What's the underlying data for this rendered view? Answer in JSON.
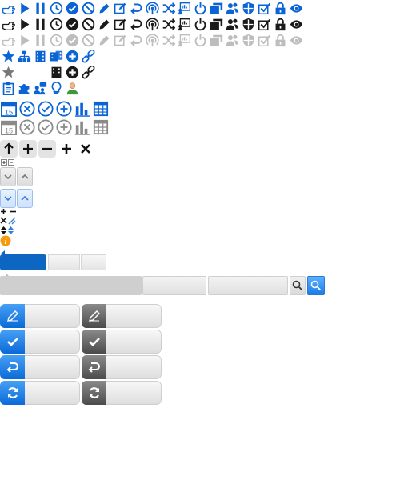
{
  "colors": {
    "accent": "#0a64d6",
    "dark": "#1a1a1a",
    "disabled": "#bdbdbd",
    "orange": "#f59a0a",
    "tab_selected": "#0c66c2"
  },
  "toolbar_icons": [
    "pointing-hand-icon",
    "play-icon",
    "pause-icon",
    "clock-icon",
    "check-circle-icon",
    "block-icon",
    "pencil-icon",
    "edit-icon",
    "undo-icon",
    "broadcast-icon",
    "shuffle-icon",
    "chart-board-icon",
    "power-icon",
    "windows-icon",
    "users-icon",
    "shield-icon",
    "checkbox-icon",
    "lock-icon",
    "eye-icon"
  ],
  "toolbar_rows": [
    "blue",
    "dark",
    "gray"
  ],
  "misc_row1": [
    "star-badge-icon",
    "sitemap-icon",
    "film-icon",
    "film-pair-icon",
    "add-circle-icon",
    "link-icon"
  ],
  "misc_row2": [
    "star-gray-icon",
    "film-dark-icon",
    "add-circle-dark-icon",
    "link-dark-icon"
  ],
  "misc_row3": [
    "clipboard-icon",
    "puzzle-icon",
    "chat-users-icon",
    "lightbulb-icon",
    "user-icon"
  ],
  "big_icons": [
    "calendar-icon",
    "remove-circle-icon",
    "ok-circle-icon",
    "add-circle-outline-icon",
    "bar-chart-icon",
    "grid-icon"
  ],
  "calendar_day": "15",
  "small_buttons": [
    "arrow-up-icon",
    "plus-icon",
    "minus-icon",
    "plus-bold-icon",
    "close-icon"
  ],
  "commands": [
    "edit",
    "check",
    "undo",
    "refresh"
  ]
}
